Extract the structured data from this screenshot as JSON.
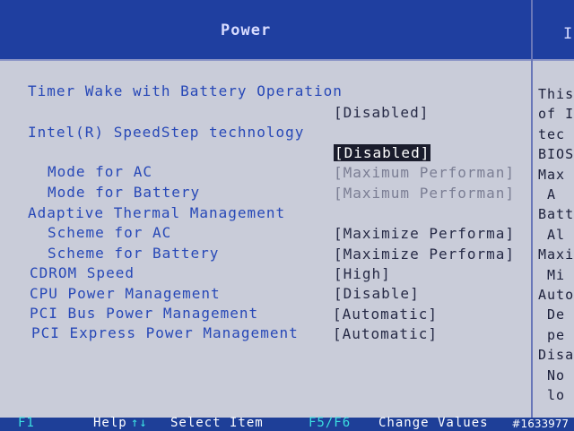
{
  "header": {
    "title": "Power",
    "help_tab": "I"
  },
  "items": [
    {
      "label": "Timer Wake with Battery Operation"
    },
    {
      "label": "Intel(R) SpeedStep technology"
    },
    {
      "label": "Mode for AC"
    },
    {
      "label": "Mode for Battery"
    },
    {
      "label": "Adaptive Thermal Management"
    },
    {
      "label": "Scheme for AC"
    },
    {
      "label": "Scheme for Battery"
    },
    {
      "label": "CDROM Speed"
    },
    {
      "label": "CPU Power Management"
    },
    {
      "label": "PCI Bus Power Management"
    },
    {
      "label": "PCI Express Power Management"
    }
  ],
  "values": {
    "timer_wake": "[Disabled]",
    "speedstep": "[Disabled]",
    "mode_ac": "[Maximum Performan]",
    "mode_battery": "[Maximum Performan]",
    "scheme_ac": "[Maximize Performa]",
    "scheme_battery": "[Maximize Performa]",
    "cdrom_speed": "[High]",
    "cpu_power": "[Disable]",
    "pci_bus": "[Automatic]",
    "pci_express": "[Automatic]"
  },
  "help_panel": {
    "text": "This\nof I\ntec\nBIOS\nMax\n A\nBatt\n Al\nMaxi\n Mi\nAuto\n De\n pe\nDisa\n No\n lo"
  },
  "status_bar": {
    "f1_key": "F1",
    "help_label": "Help",
    "nav_key": "↑↓",
    "select_label": "Select Item",
    "f5f6_key": "F5/F6",
    "change_label": "Change Values"
  },
  "watermark": "#1633977",
  "colors": {
    "title_bar": "#1f3fa0",
    "body": "#c9ccd9",
    "label": "#2748b7",
    "value": "#262a46",
    "highlight": "#1a1c2c",
    "status_bar": "#1e3f98",
    "status_key": "#3be0e0"
  }
}
